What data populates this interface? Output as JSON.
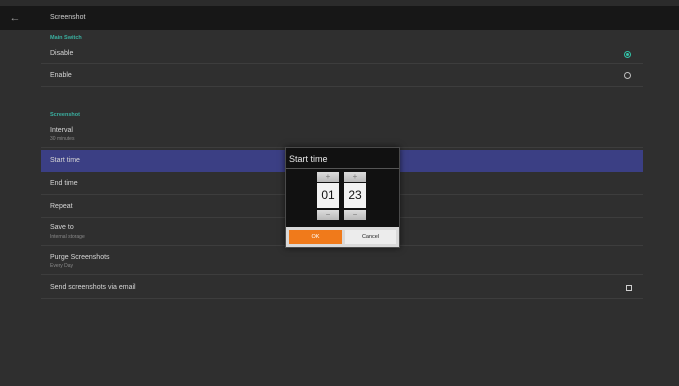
{
  "header": {
    "back_icon": "arrow-left-icon",
    "title": "Screenshot"
  },
  "main_switch": {
    "section_label": "Main Switch",
    "options": [
      {
        "label": "Disable",
        "selected": true
      },
      {
        "label": "Enable",
        "selected": false
      }
    ]
  },
  "screenshot": {
    "section_label": "Screenshot",
    "interval": {
      "label": "Interval",
      "value": "30 minutes"
    },
    "start_time": {
      "label": "Start time"
    },
    "end_time": {
      "label": "End time"
    },
    "repeat": {
      "label": "Repeat"
    },
    "save_to": {
      "label": "Save to",
      "value": "Internal storage"
    },
    "purge": {
      "label": "Purge Screenshots",
      "value": "Every Day"
    },
    "email": {
      "label": "Send screenshots via email",
      "checked": false
    }
  },
  "dialog": {
    "title": "Start time",
    "hours": "01",
    "minutes": "23",
    "plus": "+",
    "minus": "−",
    "ok_label": "OK",
    "cancel_label": "Cancel"
  },
  "colors": {
    "accent": "#32c3a7",
    "selected_row": "#3b3f84",
    "ok_button": "#f07a1b"
  }
}
